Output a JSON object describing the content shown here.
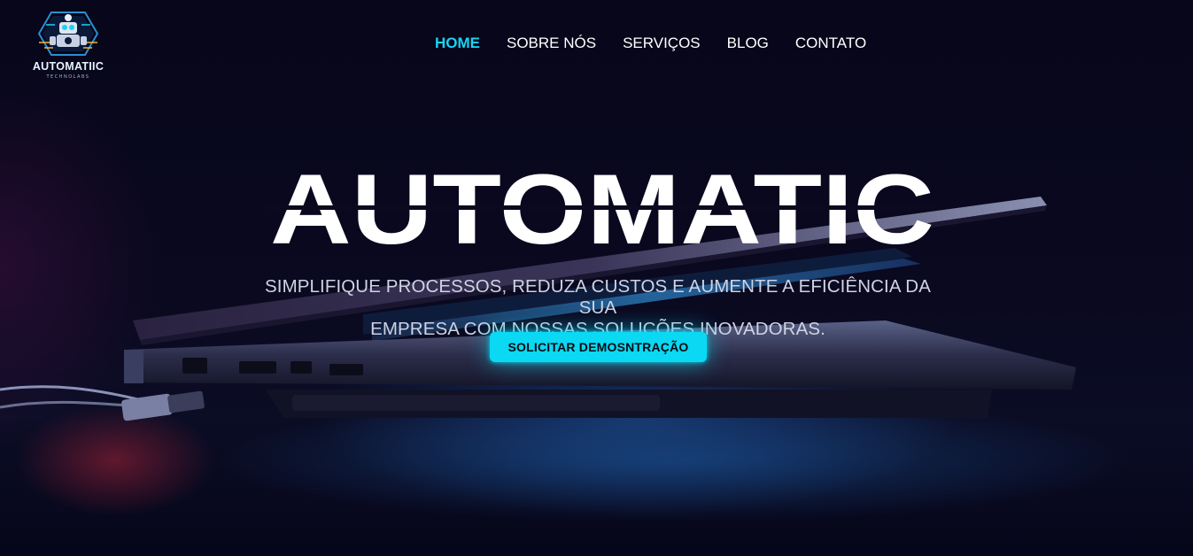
{
  "brand": {
    "name": "AUTOMATIIC",
    "tagline": "TECHNOLABS",
    "icon": "robot-logo-icon"
  },
  "nav": {
    "items": [
      {
        "label": "HOME",
        "active": true
      },
      {
        "label": "SOBRE NÓS",
        "active": false
      },
      {
        "label": "SERVIÇOS",
        "active": false
      },
      {
        "label": "BLOG",
        "active": false
      },
      {
        "label": "CONTATO",
        "active": false
      }
    ]
  },
  "hero": {
    "title": "AUTOMATIC",
    "subtitle_line1": "SIMPLIFIQUE PROCESSOS, REDUZA CUSTOS E AUMENTE A EFICIÊNCIA DA SUA",
    "subtitle_line2": "EMPRESA COM NOSSAS SOLUÇÕES INOVADORAS.",
    "cta_label": "SOLICITAR DEMOSNTRAÇÃO",
    "background_image": "laptop-photo"
  },
  "colors": {
    "accent": "#19d3f3",
    "cta_bg": "#0bd8f2",
    "background": "#07061a",
    "text": "#ffffff"
  }
}
